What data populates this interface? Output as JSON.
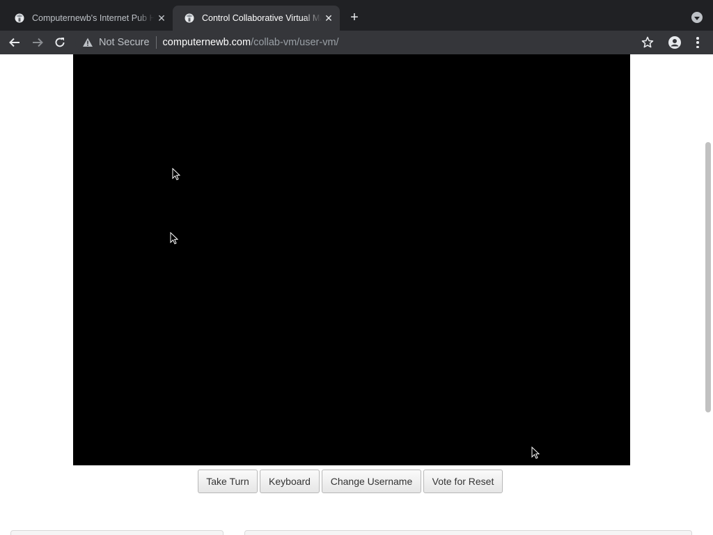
{
  "browser": {
    "tabs": [
      {
        "title": "Computernewb's Internet Pub Hub",
        "active": false
      },
      {
        "title": "Control Collaborative Virtual Machines",
        "active": true
      }
    ],
    "security_label": "Not Secure",
    "url_host": "computernewb.com",
    "url_path": "/collab-vm/user-vm/"
  },
  "vm": {
    "screen_color": "#000000"
  },
  "controls": {
    "take_turn": "Take Turn",
    "keyboard": "Keyboard",
    "change_username": "Change Username",
    "vote_reset": "Vote for Reset"
  },
  "colors": {
    "tabstrip": "#202124",
    "toolbar": "#35363a",
    "button_text": "#333333"
  }
}
